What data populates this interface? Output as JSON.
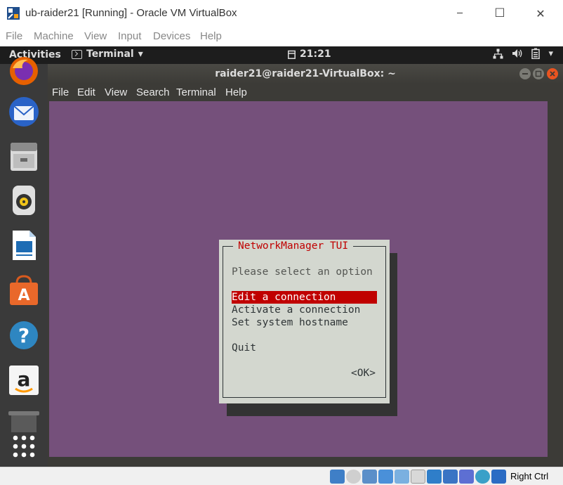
{
  "host_window": {
    "title": "ub-raider21 [Running] - Oracle VM VirtualBox",
    "controls": {
      "minimize": "─",
      "maximize": "☐",
      "close": "✕"
    },
    "menu": [
      "File",
      "Machine",
      "View",
      "Input",
      "Devices",
      "Help"
    ]
  },
  "gnome_topbar": {
    "activities": "Activities",
    "app_menu": "Terminal",
    "app_menu_arrow": "▾",
    "clock": "21:21",
    "tray_arrow": "▾"
  },
  "dock": {
    "items": [
      "firefox-icon",
      "thunderbird-icon",
      "files-icon",
      "rhythmbox-icon",
      "libreoffice-writer-icon",
      "ubuntu-software-icon",
      "help-icon",
      "amazon-icon",
      "trash-icon",
      "show-apps-icon"
    ]
  },
  "terminal": {
    "title": "raider21@raider21-VirtualBox: ~",
    "menu": [
      "File",
      "Edit",
      "View",
      "Search",
      "Terminal",
      "Help"
    ],
    "background_color": "#75507b"
  },
  "tui": {
    "title": "NetworkManager TUI",
    "prompt": "Please select an option",
    "options": [
      "Edit a connection",
      "Activate a connection",
      "Set system hostname"
    ],
    "quit": "Quit",
    "ok": "<OK>",
    "selected_index": 0,
    "accent_color": "#c00000"
  },
  "statusbar": {
    "host_key": "Right Ctrl"
  }
}
